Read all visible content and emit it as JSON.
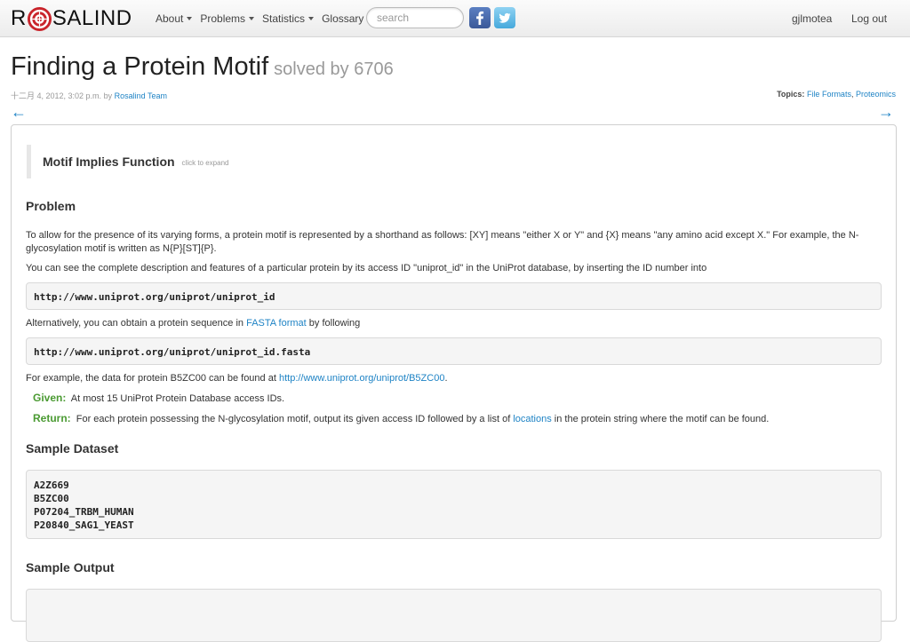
{
  "nav": {
    "brand_r": "R",
    "brand_rest": "SALIND",
    "menu": [
      {
        "label": "About",
        "has_caret": true
      },
      {
        "label": "Problems",
        "has_caret": true
      },
      {
        "label": "Statistics",
        "has_caret": true
      },
      {
        "label": "Glossary",
        "has_caret": false
      }
    ],
    "search_placeholder": "search",
    "social": [
      "facebook-icon",
      "twitter-icon"
    ],
    "user": "gjlmotea",
    "logout": "Log out"
  },
  "header": {
    "title": "Finding a Protein Motif",
    "solved_by": "solved by 6706",
    "date": "十二月 4, 2012, 3:02 p.m.",
    "by_label": "by",
    "author": "Rosalind Team",
    "topics_label": "Topics:",
    "topics": [
      "File Formats",
      "Proteomics"
    ],
    "topics_sep": ",",
    "prev_arrow": "←",
    "next_arrow": "→"
  },
  "content": {
    "expander": {
      "title": "Motif Implies Function",
      "hint": "click to expand"
    },
    "problem_heading": "Problem",
    "intro_1": "To allow for the presence of its varying forms, a protein motif is represented by a shorthand as follows: [XY] means \"either X or Y\" and {X} means \"any amino acid except X.\" For example, the N-glycosylation motif is written as N{P}[ST]{P}.",
    "intro_2": "You can see the complete description and features of a particular protein by its access ID \"uniprot_id\" in the UniProt database, by inserting the ID number into",
    "url_1": "http://www.uniprot.org/uniprot/uniprot_id",
    "alt_text_before": "Alternatively, you can obtain a protein sequence in",
    "alt_link": "FASTA format",
    "alt_text_after": "by following",
    "url_2": "http://www.uniprot.org/uniprot/uniprot_id.fasta",
    "example_before": "For example, the data for protein B5ZC00 can be found at",
    "example_link": "http://www.uniprot.org/uniprot/B5ZC00",
    "example_after": ".",
    "given_label": "Given:",
    "given_text": "At most 15 UniProt Protein Database access IDs.",
    "return_label": "Return:",
    "return_before": "For each protein possessing the N-glycosylation motif, output its given access ID followed by a list of",
    "return_link": "locations",
    "return_after": "in the protein string where the motif can be found.",
    "sample_dataset_heading": "Sample Dataset",
    "sample_dataset": [
      "A2Z669",
      "B5ZC00",
      "P07204_TRBM_HUMAN",
      "P20840_SAG1_YEAST"
    ],
    "sample_output_heading": "Sample Output"
  },
  "colors": {
    "link": "#1e83c5",
    "given_label": "#4a9a32",
    "muted": "#999999"
  }
}
